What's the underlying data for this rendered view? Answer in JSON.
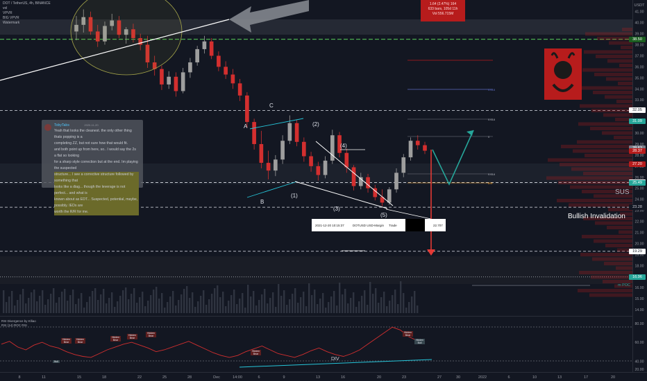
{
  "legend": {
    "symbol_line": "DOT / TetherUS, 4h, BINANCE",
    "line2": "vol",
    "line3": "VPVR",
    "line4": "BIG VPVR",
    "line5": "Watermark"
  },
  "callout": {
    "line1": "1.64 (2.47%) 164",
    "line2": "633 bars, 105d 11h",
    "line3": "Vol 556.715M"
  },
  "comment": {
    "author": "TobyTabs",
    "time": "2020-11-20",
    "text1": "Yeah that looks the cleanest. the only other thing thats popping is a",
    "text2": "completing ZZ, but not sure how that would fit.",
    "text3": "and both point up from here, so.. I would say the 2s a flat so looking",
    "text4": "for a sharp style correction but at the end. Im playing the suspected",
    "text5": "structure... I see a corrective structure followed by something that",
    "text6": "looks like a diag... though the leverage is not perfect... and what is",
    "text7": "known about as EDT... Suspected, potential, maybe, possibly. IEDs are",
    "text8": "worth the R/R for me."
  },
  "trade_row": {
    "date": "2021-12-20 10:15:37",
    "pair": "DOTUSD USD-Margin",
    "type": "Trade",
    "amount": "22.707"
  },
  "annotations": {
    "wave_A": "A",
    "wave_B": "B",
    "wave_C": "C",
    "wave_1": "(1)",
    "wave_2": "(2)",
    "wave_3": "(3)",
    "wave_4": "(4)",
    "wave_5": "(5)",
    "sus": "SUS",
    "bullish_invalidation": "Bullish Invalidation",
    "mpoc": "m POC",
    "div": "DIV",
    "rsi_title": "RSI Divergence by Klliao",
    "rsi_sub": "RSI (14) ROC RSI"
  },
  "fib_labels": [
    "0.618",
    "0.5",
    "0.618",
    "0",
    "0.618"
  ],
  "rsi_tags": [
    "Hidden Bear",
    "Hidden Bear",
    "Hidden Bear",
    "Hidden Bear",
    "Hidden Bear",
    "Hidden Bear",
    "Hidden Bear",
    "Hidden Bull",
    "Bull"
  ],
  "price_axis": {
    "currency": "USDT",
    "ticks": [
      "41.00",
      "40.00",
      "39.00",
      "38.00",
      "37.00",
      "36.00",
      "35.00",
      "34.00",
      "33.00",
      "32.00",
      "31.00",
      "30.00",
      "29.00",
      "28.00",
      "27.00",
      "26.00",
      "25.00",
      "24.00",
      "23.00",
      "22.00",
      "21.00",
      "20.00",
      "19.00",
      "18.00",
      "17.00",
      "16.00",
      "15.00",
      "14.00"
    ],
    "tags": [
      {
        "label": "38.50",
        "bg": "#1b5e20",
        "fg": "#ffffff"
      },
      {
        "label": "32.05",
        "bg": "#ffffff",
        "fg": "#131722"
      },
      {
        "label": "31.09",
        "bg": "#26a69a",
        "fg": "#ffffff"
      },
      {
        "label": "28.63",
        "bg": "#787b86",
        "fg": "#ffffff"
      },
      {
        "label": "28.37",
        "bg": "#b71c1c",
        "fg": "#ffffff"
      },
      {
        "label": "52:17",
        "bg": "#b71c1c",
        "fg": "#ffffff"
      },
      {
        "label": "27.20",
        "bg": "#b71c1c",
        "fg": "#ffffff"
      },
      {
        "label": "25.52",
        "bg": "#ffffff",
        "fg": "#131722"
      },
      {
        "label": "25.49",
        "bg": "#26a69a",
        "fg": "#ffffff"
      },
      {
        "label": "23.28",
        "bg": "#131722",
        "fg": "#d1d4dc"
      },
      {
        "label": "19.29",
        "bg": "#ffffff",
        "fg": "#131722"
      },
      {
        "label": "16.96",
        "bg": "#26a69a",
        "fg": "#ffffff"
      }
    ]
  },
  "rsi_axis": {
    "ticks": [
      "80.00",
      "60.00",
      "40.00"
    ],
    "tag": "20.00"
  },
  "time_axis": {
    "ticks": [
      "8",
      "11",
      "15",
      "18",
      "22",
      "25",
      "28",
      "Dec",
      "14:00",
      "6",
      "9",
      "13",
      "16",
      "20",
      "23",
      "27",
      "30",
      "2022",
      "6",
      "10",
      "13",
      "17",
      "20"
    ]
  },
  "chart_data": {
    "type": "candlestick",
    "title": "DOT / TetherUS, 4h, BINANCE",
    "ylabel": "USDT",
    "ylim": [
      13.5,
      41.8
    ],
    "candles": [
      {
        "o": 39.2,
        "h": 40.6,
        "l": 38.4,
        "c": 39.8
      },
      {
        "o": 39.8,
        "h": 41.2,
        "l": 39.1,
        "c": 40.5
      },
      {
        "o": 40.5,
        "h": 41.0,
        "l": 38.9,
        "c": 39.2
      },
      {
        "o": 39.2,
        "h": 39.8,
        "l": 37.8,
        "c": 38.3
      },
      {
        "o": 38.3,
        "h": 40.1,
        "l": 38.0,
        "c": 39.7
      },
      {
        "o": 39.7,
        "h": 40.8,
        "l": 39.3,
        "c": 40.2
      },
      {
        "o": 40.2,
        "h": 40.6,
        "l": 38.6,
        "c": 38.9
      },
      {
        "o": 38.9,
        "h": 39.6,
        "l": 38.1,
        "c": 39.4
      },
      {
        "o": 39.4,
        "h": 39.9,
        "l": 38.2,
        "c": 38.6
      },
      {
        "o": 38.6,
        "h": 39.0,
        "l": 37.5,
        "c": 38.0
      },
      {
        "o": 38.0,
        "h": 38.8,
        "l": 35.9,
        "c": 36.4
      },
      {
        "o": 36.4,
        "h": 37.0,
        "l": 35.2,
        "c": 35.8
      },
      {
        "o": 35.8,
        "h": 36.1,
        "l": 33.9,
        "c": 34.4
      },
      {
        "o": 34.4,
        "h": 35.6,
        "l": 34.0,
        "c": 35.1
      },
      {
        "o": 35.1,
        "h": 35.5,
        "l": 33.3,
        "c": 33.8
      },
      {
        "o": 33.8,
        "h": 35.9,
        "l": 33.6,
        "c": 35.5
      },
      {
        "o": 35.5,
        "h": 36.8,
        "l": 35.0,
        "c": 36.4
      },
      {
        "o": 36.4,
        "h": 37.9,
        "l": 36.1,
        "c": 37.6
      },
      {
        "o": 37.6,
        "h": 38.8,
        "l": 37.2,
        "c": 38.3
      },
      {
        "o": 38.3,
        "h": 38.6,
        "l": 36.7,
        "c": 37.0
      },
      {
        "o": 37.0,
        "h": 37.4,
        "l": 35.6,
        "c": 36.0
      },
      {
        "o": 36.0,
        "h": 36.5,
        "l": 34.9,
        "c": 35.3
      },
      {
        "o": 35.3,
        "h": 35.8,
        "l": 34.0,
        "c": 34.5
      },
      {
        "o": 34.5,
        "h": 34.9,
        "l": 32.9,
        "c": 33.4
      },
      {
        "o": 33.4,
        "h": 33.7,
        "l": 30.5,
        "c": 31.0
      },
      {
        "o": 31.0,
        "h": 31.3,
        "l": 28.5,
        "c": 29.0
      },
      {
        "o": 29.0,
        "h": 30.2,
        "l": 26.8,
        "c": 27.3
      },
      {
        "o": 27.3,
        "h": 28.4,
        "l": 25.8,
        "c": 26.6
      },
      {
        "o": 26.6,
        "h": 28.0,
        "l": 26.1,
        "c": 27.6
      },
      {
        "o": 27.6,
        "h": 29.8,
        "l": 27.2,
        "c": 29.3
      },
      {
        "o": 29.3,
        "h": 31.6,
        "l": 29.0,
        "c": 30.9
      },
      {
        "o": 30.9,
        "h": 31.2,
        "l": 28.8,
        "c": 29.2
      },
      {
        "o": 29.2,
        "h": 29.6,
        "l": 27.4,
        "c": 27.9
      },
      {
        "o": 27.9,
        "h": 28.3,
        "l": 26.5,
        "c": 27.0
      },
      {
        "o": 27.0,
        "h": 27.4,
        "l": 25.7,
        "c": 26.2
      },
      {
        "o": 26.2,
        "h": 27.9,
        "l": 25.9,
        "c": 27.5
      },
      {
        "o": 27.5,
        "h": 30.3,
        "l": 27.2,
        "c": 29.8
      },
      {
        "o": 29.8,
        "h": 30.1,
        "l": 27.8,
        "c": 28.2
      },
      {
        "o": 28.2,
        "h": 28.6,
        "l": 26.4,
        "c": 26.9
      },
      {
        "o": 26.9,
        "h": 27.1,
        "l": 24.8,
        "c": 25.2
      },
      {
        "o": 25.2,
        "h": 26.4,
        "l": 24.9,
        "c": 26.0
      },
      {
        "o": 26.0,
        "h": 26.3,
        "l": 24.6,
        "c": 25.0
      },
      {
        "o": 25.0,
        "h": 25.3,
        "l": 23.9,
        "c": 24.2
      },
      {
        "o": 24.2,
        "h": 24.9,
        "l": 23.4,
        "c": 23.7
      },
      {
        "o": 23.7,
        "h": 25.1,
        "l": 23.5,
        "c": 24.9
      },
      {
        "o": 24.9,
        "h": 26.8,
        "l": 24.6,
        "c": 26.4
      },
      {
        "o": 26.4,
        "h": 28.1,
        "l": 26.0,
        "c": 27.8
      },
      {
        "o": 27.8,
        "h": 29.6,
        "l": 27.5,
        "c": 29.3
      },
      {
        "o": 29.3,
        "h": 29.8,
        "l": 28.5,
        "c": 28.9
      },
      {
        "o": 28.9,
        "h": 29.2,
        "l": 28.1,
        "c": 28.4
      }
    ],
    "levels": [
      {
        "price": 38.5,
        "style": "dashed-green"
      },
      {
        "price": 32.05,
        "style": "dashed-white"
      },
      {
        "price": 25.52,
        "style": "dashed-white"
      },
      {
        "price": 23.28,
        "style": "dashed-white"
      },
      {
        "price": 19.29,
        "style": "dashed-white"
      },
      {
        "price": 16.96,
        "style": "dotted-white"
      }
    ],
    "projection": [
      {
        "price": 28.6
      },
      {
        "price": 25.8
      },
      {
        "price": 31.0
      }
    ],
    "rsi": {
      "ylim": [
        30,
        85
      ],
      "values": [
        58,
        61,
        55,
        52,
        57,
        60,
        56,
        54,
        50,
        47,
        45,
        44,
        48,
        52,
        55,
        58,
        60,
        57,
        54,
        50,
        52,
        55,
        58,
        61,
        57,
        53,
        49,
        46,
        44,
        46,
        50,
        53,
        56,
        52,
        48,
        46,
        44,
        47,
        51,
        54,
        50,
        47,
        45,
        48,
        52,
        58,
        64,
        70,
        76,
        73,
        66,
        62,
        60
      ]
    }
  }
}
